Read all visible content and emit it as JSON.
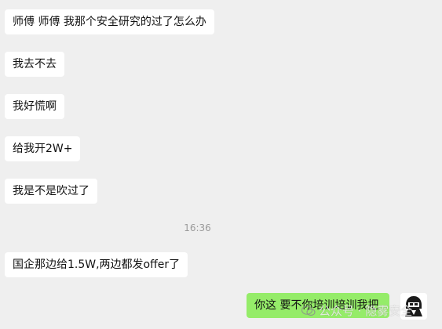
{
  "messages_in": [
    "师傅 师傅 我那个安全研究的过了怎么办",
    "我去不去",
    "我好慌啊",
    "给我开2W+",
    "我是不是吹过了",
    "国企那边给1.5W,两边都发offer了"
  ],
  "timestamp": "16:36",
  "message_out": "你这 要不你培训培训我把",
  "watermark": "公众号 · 隐雾安全",
  "icons": {
    "avatar": "hooded-figure-avatar-icon",
    "watermark": "wechat-official-account-icon"
  },
  "colors": {
    "background": "#efefef",
    "incoming_bubble": "#ffffff",
    "outgoing_bubble": "#95ec69"
  }
}
